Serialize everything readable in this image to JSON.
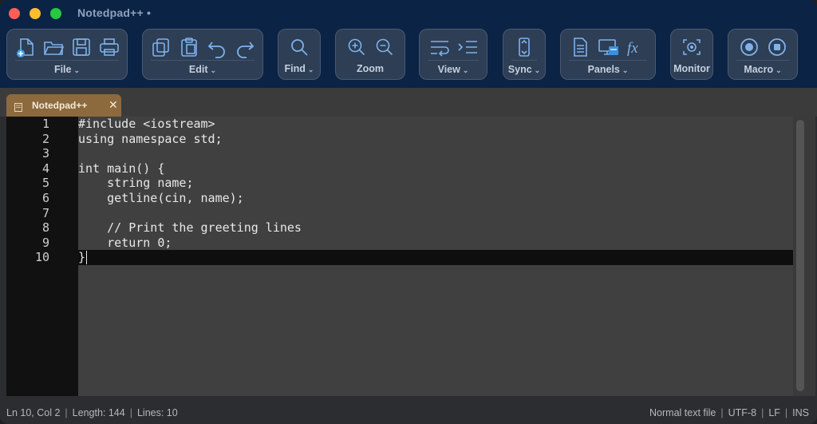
{
  "window": {
    "title": "Notedpad++ •"
  },
  "toolbar": {
    "file": {
      "label": "File",
      "icons": [
        "new-file-icon",
        "open-folder-icon",
        "save-icon",
        "print-icon"
      ]
    },
    "edit": {
      "label": "Edit",
      "icons": [
        "copy-icon",
        "paste-icon",
        "undo-icon",
        "redo-icon"
      ]
    },
    "find": {
      "label": "Find",
      "icons": [
        "search-icon"
      ]
    },
    "zoom": {
      "label": "Zoom",
      "icons": [
        "zoom-in-icon",
        "zoom-out-icon"
      ]
    },
    "view": {
      "label": "View",
      "icons": [
        "word-wrap-icon",
        "indent-icon"
      ]
    },
    "sync": {
      "label": "Sync",
      "icons": [
        "sync-scroll-icon"
      ]
    },
    "panels": {
      "label": "Panels",
      "icons": [
        "document-panel-icon",
        "monitor-panel-icon"
      ],
      "fx_glyph": "fx"
    },
    "monitor": {
      "label": "Monitor",
      "icons": [
        "monitor-icon"
      ]
    },
    "macro": {
      "label": "Macro",
      "icons": [
        "record-icon",
        "stop-icon"
      ]
    }
  },
  "tabs": [
    {
      "label": "Notedpad++",
      "close": "✕"
    }
  ],
  "editor": {
    "line_numbers": [
      "1",
      "2",
      "3",
      "4",
      "5",
      "6",
      "7",
      "8",
      "9",
      "10"
    ],
    "lines": [
      "#include <iostream>",
      "using namespace std;",
      "",
      "int main() {",
      "    string name;",
      "    getline(cin, name);",
      "",
      "    // Print the greeting lines",
      "    return 0;",
      "}"
    ]
  },
  "status": {
    "position": "Ln 10, Col 2",
    "length": "Length: 144",
    "lines": "Lines: 10",
    "file_type": "Normal text file",
    "encoding": "UTF-8",
    "eol": "LF",
    "mode": "INS"
  },
  "colors": {
    "titlebar": "#0b2345",
    "toolbar_group": "#2d3e55",
    "icon_accent": "#7fb2ea",
    "tab_active": "#8c6a3e",
    "editor_bg": "#404040",
    "gutter_bg": "#111111",
    "current_line": "#0e0e0e"
  }
}
